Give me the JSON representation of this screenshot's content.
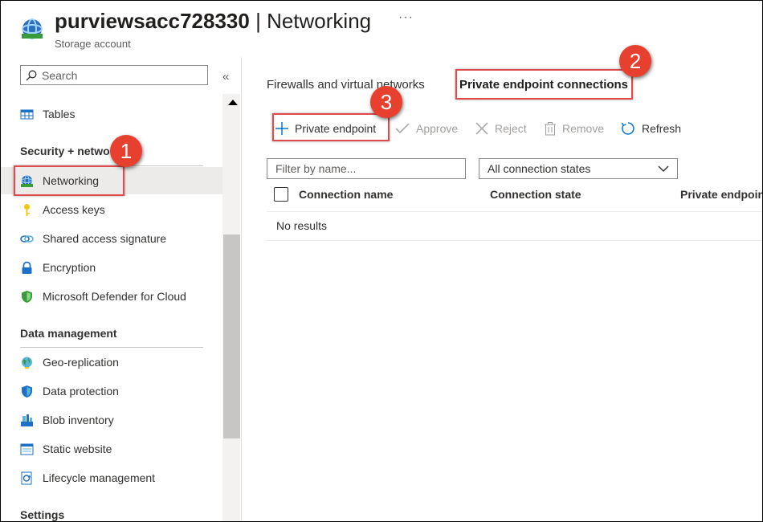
{
  "header": {
    "resource_name": "purviewsacc728330",
    "separator": " | ",
    "page": "Networking",
    "subtitle": "Storage account",
    "more": "···"
  },
  "sidebar": {
    "search_placeholder": "Search",
    "collapse": "«",
    "items": [
      {
        "label": "Tables",
        "icon": "table-icon"
      },
      {
        "label": "Networking",
        "icon": "networking-icon",
        "active": true
      },
      {
        "label": "Access keys",
        "icon": "key-icon"
      },
      {
        "label": "Shared access signature",
        "icon": "link-icon"
      },
      {
        "label": "Encryption",
        "icon": "lock-icon"
      },
      {
        "label": "Microsoft Defender for Cloud",
        "icon": "shield-icon"
      },
      {
        "label": "Geo-replication",
        "icon": "globe-icon"
      },
      {
        "label": "Data protection",
        "icon": "shield-icon"
      },
      {
        "label": "Blob inventory",
        "icon": "inventory-icon"
      },
      {
        "label": "Static website",
        "icon": "website-icon"
      },
      {
        "label": "Lifecycle management",
        "icon": "lifecycle-icon"
      }
    ],
    "sections": {
      "security": "Security + netwo",
      "data_management": "Data management",
      "settings": "Settings"
    }
  },
  "tabs": {
    "firewalls": "Firewalls and virtual networks",
    "private": "Private endpoint connections"
  },
  "toolbar": {
    "add": "Private endpoint",
    "approve": "Approve",
    "reject": "Reject",
    "remove": "Remove",
    "refresh": "Refresh"
  },
  "filters": {
    "name_placeholder": "Filter by name...",
    "state_selected": "All connection states"
  },
  "table": {
    "columns": [
      "Connection name",
      "Connection state",
      "Private endpoin"
    ],
    "empty": "No results"
  },
  "callouts": [
    "1",
    "2",
    "3"
  ],
  "colors": {
    "accent": "#0078d4",
    "callout": "#e8402e"
  }
}
